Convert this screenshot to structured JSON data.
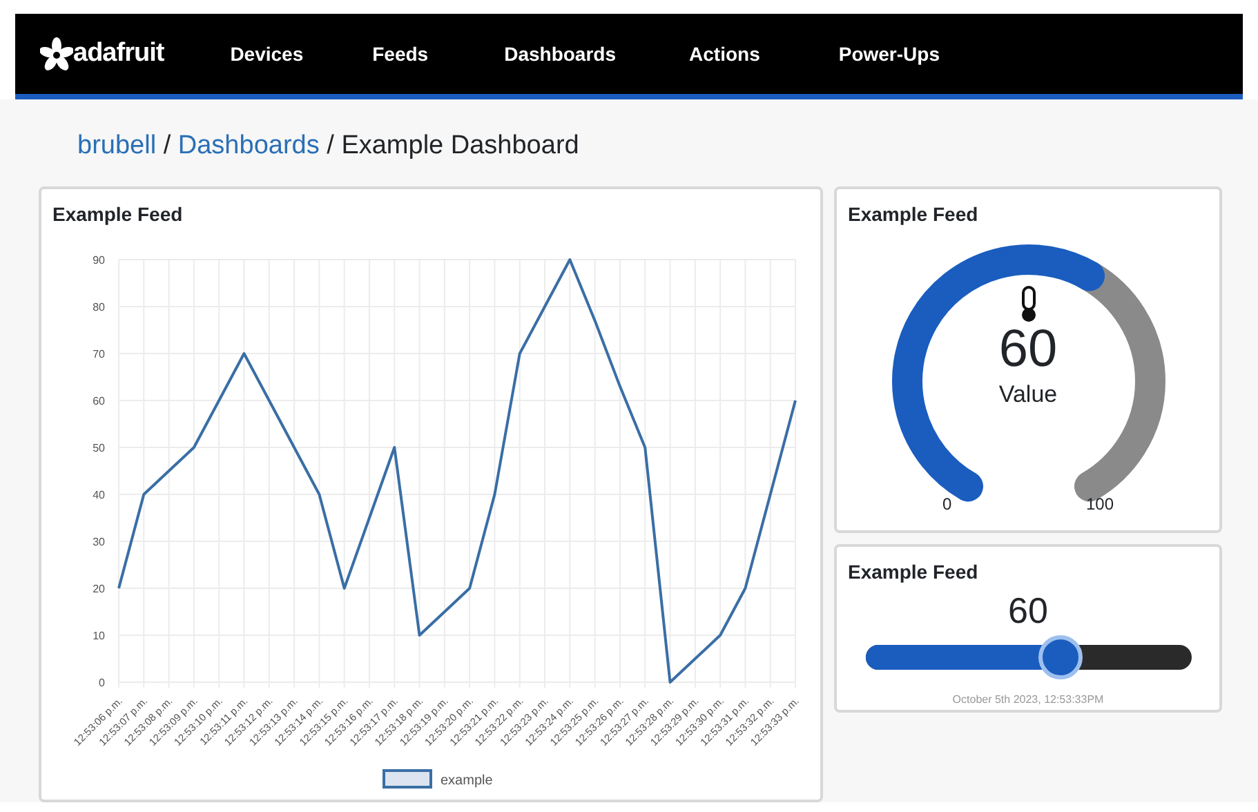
{
  "navbar": {
    "logo_text": "adafruit",
    "items": [
      "Devices",
      "Feeds",
      "Dashboards",
      "Actions",
      "Power-Ups"
    ]
  },
  "breadcrumb": {
    "separator": "/",
    "items": [
      {
        "label": "brubell",
        "link": true
      },
      {
        "label": "Dashboards",
        "link": true
      },
      {
        "label": "Example Dashboard",
        "link": false
      }
    ]
  },
  "line_chart_block": {
    "title": "Example Feed",
    "chart_data": {
      "type": "line",
      "categories": [
        "12:53:06 p.m.",
        "12:53:07 p.m.",
        "12:53:08 p.m.",
        "12:53:09 p.m.",
        "12:53:10 p.m.",
        "12:53:11 p.m.",
        "12:53:12 p.m.",
        "12:53:13 p.m.",
        "12:53:14 p.m.",
        "12:53:15 p.m.",
        "12:53:16 p.m.",
        "12:53:17 p.m.",
        "12:53:18 p.m.",
        "12:53:19 p.m.",
        "12:53:20 p.m.",
        "12:53:21 p.m.",
        "12:53:22 p.m.",
        "12:53:23 p.m.",
        "12:53:24 p.m.",
        "12:53:25 p.m.",
        "12:53:26 p.m.",
        "12:53:27 p.m.",
        "12:53:28 p.m.",
        "12:53:29 p.m.",
        "12:53:30 p.m.",
        "12:53:31 p.m.",
        "12:53:32 p.m.",
        "12:53:33 p.m."
      ],
      "series": [
        {
          "name": "example",
          "color": "#3a6ea5",
          "values": [
            20,
            40,
            45,
            50,
            60,
            70,
            60,
            50,
            40,
            20,
            35,
            50,
            10,
            15,
            20,
            40,
            70,
            80,
            90,
            77,
            63,
            50,
            0,
            5,
            10,
            20,
            40,
            60
          ]
        }
      ],
      "grid": true,
      "ylim": [
        0,
        90
      ],
      "yticks": [
        0,
        10,
        20,
        30,
        40,
        50,
        60,
        70,
        80,
        90
      ]
    }
  },
  "gauge_block": {
    "title": "Example Feed",
    "value": "60",
    "label": "Value",
    "min_label": "0",
    "max_label": "100"
  },
  "slider_block": {
    "title": "Example Feed",
    "value": "60",
    "level": 0.6,
    "timestamp": "October 5th 2023, 12:53:33PM"
  }
}
